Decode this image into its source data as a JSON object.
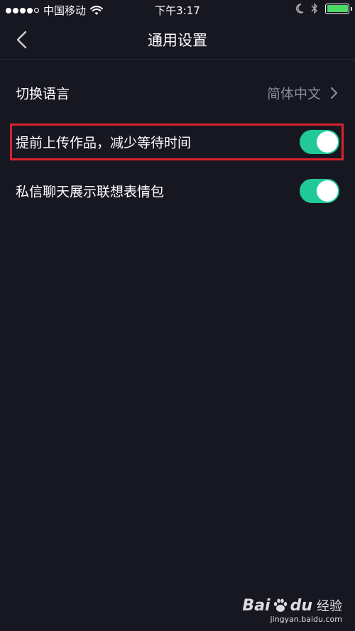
{
  "status_bar": {
    "carrier": "中国移动",
    "time": "下午3:17",
    "signal_bars_filled": 4,
    "signal_bars_total": 5,
    "battery_level": 1.0
  },
  "nav": {
    "title": "通用设置",
    "back_icon": "chevron-left-icon"
  },
  "settings": {
    "language": {
      "label": "切换语言",
      "value": "简体中文"
    },
    "upload_ahead": {
      "label": "提前上传作品，减少等待时间",
      "enabled": true
    },
    "chat_emoji": {
      "label": "私信聊天展示联想表情包",
      "enabled": true
    }
  },
  "colors": {
    "background": "#171722",
    "toggle_on": "#20c997",
    "highlight": "#d9232a",
    "secondary_text": "#8a8a96"
  },
  "watermark": {
    "brand_left": "Bai",
    "brand_right": "du",
    "brand_sub": "经验",
    "url": "jingyan.baidu.com"
  }
}
